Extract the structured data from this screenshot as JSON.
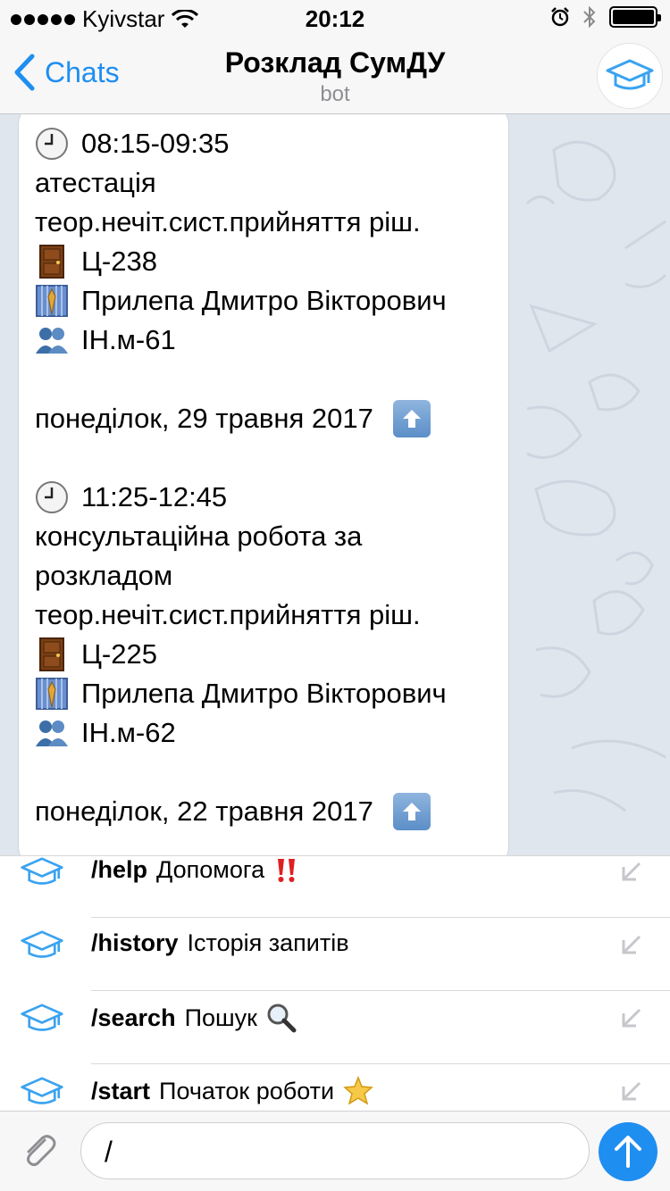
{
  "status_bar": {
    "carrier": "Kyivstar",
    "time": "20:12"
  },
  "nav": {
    "back_label": "Chats",
    "title": "Розклад СумДУ",
    "subtitle": "bot"
  },
  "message": {
    "entry1": {
      "time": "08:15-09:35",
      "type": "атестація",
      "subject": "теор.нечіт.сист.прийняття ріш.",
      "room": "Ц-238",
      "teacher": "Прилепа Дмитро Вікторович",
      "group": "ІН.м-61"
    },
    "date1": "понеділок, 29 травня 2017",
    "entry2": {
      "time": "11:25-12:45",
      "type_line1": "консультаційна робота за",
      "type_line2": "розкладом",
      "subject": "теор.нечіт.сист.прийняття ріш.",
      "room": "Ц-225",
      "teacher": "Прилепа Дмитро Вікторович",
      "group": "ІН.м-62"
    },
    "date2": "понеділок, 22 травня 2017"
  },
  "commands": [
    {
      "name": "/help",
      "description": "Допомога",
      "emoji": "double-exclamation-icon"
    },
    {
      "name": "/history",
      "description": "Історія запитів",
      "emoji": ""
    },
    {
      "name": "/search",
      "description": "Пошук",
      "emoji": "magnifier-icon"
    },
    {
      "name": "/start",
      "description": "Початок роботи",
      "emoji": "star-icon"
    }
  ],
  "input": {
    "value": "/"
  },
  "colors": {
    "accent": "#1f8ef1",
    "chat_background": "#dfe6ee",
    "bubble": "#ffffff",
    "subtitle": "#8e8e93"
  }
}
